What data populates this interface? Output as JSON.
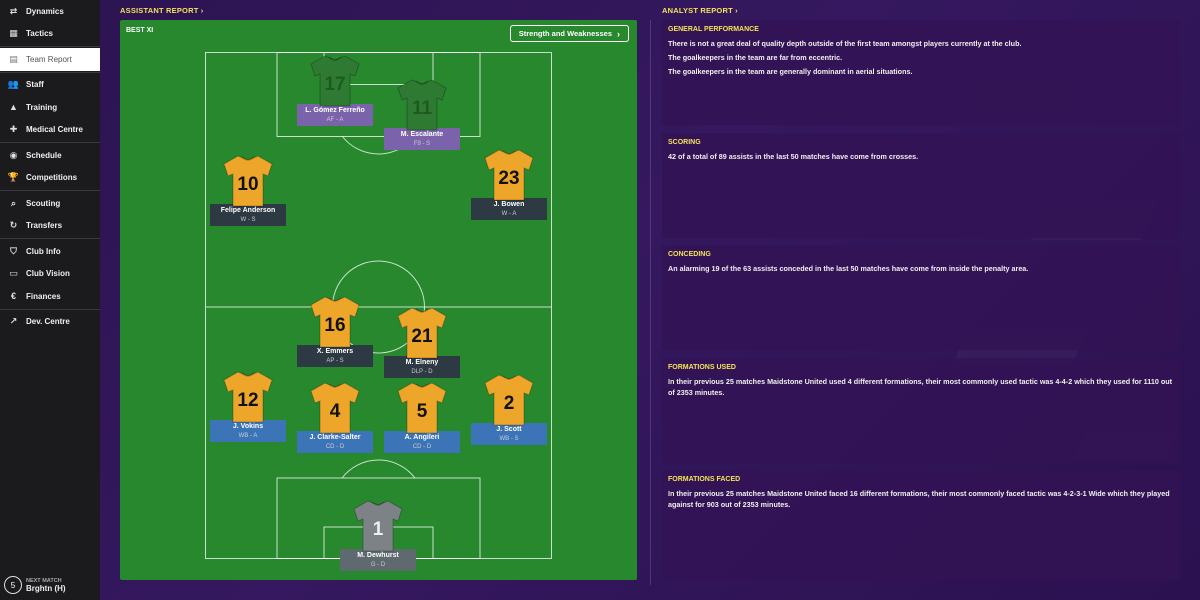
{
  "sidebar": {
    "items": [
      {
        "label": "Dynamics",
        "icon": "dynamics-icon",
        "glyph": "⇄"
      },
      {
        "label": "Tactics",
        "icon": "tactics-icon",
        "glyph": "▦"
      },
      {
        "label": "Team Report",
        "icon": "clipboard-icon",
        "glyph": "▤",
        "active": true
      },
      {
        "label": "Staff",
        "icon": "staff-icon",
        "glyph": "👥"
      },
      {
        "label": "Training",
        "icon": "training-cone-icon",
        "glyph": "▲"
      },
      {
        "label": "Medical Centre",
        "icon": "medical-cross-icon",
        "glyph": "✚"
      },
      {
        "label": "Schedule",
        "icon": "schedule-icon",
        "glyph": "◉"
      },
      {
        "label": "Competitions",
        "icon": "trophy-icon",
        "glyph": "🏆"
      },
      {
        "label": "Scouting",
        "icon": "magnifier-icon",
        "glyph": "⌕"
      },
      {
        "label": "Transfers",
        "icon": "transfers-icon",
        "glyph": "↻"
      },
      {
        "label": "Club Info",
        "icon": "shield-icon",
        "glyph": "⛉"
      },
      {
        "label": "Club Vision",
        "icon": "club-vision-icon",
        "glyph": "▭"
      },
      {
        "label": "Finances",
        "icon": "finances-icon",
        "glyph": "€"
      },
      {
        "label": "Dev. Centre",
        "icon": "dev-centre-icon",
        "glyph": "↗"
      }
    ],
    "next_match": {
      "label": "NEXT MATCH",
      "value": "Brghtn (H)",
      "days": "5"
    }
  },
  "assistant": {
    "heading": "ASSISTANT REPORT",
    "best_xi": "BEST XI",
    "sw_button": "Strength and Weaknesses",
    "players": [
      {
        "name": "L. Gómez Ferreño",
        "role": "AF  -  A",
        "number": "17",
        "kit": "green",
        "label": "purple"
      },
      {
        "name": "M. Escalante",
        "role": "F9  -  S",
        "number": "11",
        "kit": "green",
        "label": "purple"
      },
      {
        "name": "Felipe Anderson",
        "role": "W  -  S",
        "number": "10",
        "kit": "yellow",
        "label": "dark"
      },
      {
        "name": "J. Bowen",
        "role": "W  -  A",
        "number": "23",
        "kit": "yellow",
        "label": "dark"
      },
      {
        "name": "X. Emmers",
        "role": "AP  -  S",
        "number": "16",
        "kit": "yellow",
        "label": "dark"
      },
      {
        "name": "M. Elneny",
        "role": "DLP  -  D",
        "number": "21",
        "kit": "yellow",
        "label": "dark"
      },
      {
        "name": "J. Vokins",
        "role": "WB  -  A",
        "number": "12",
        "kit": "yellow",
        "label": "blue"
      },
      {
        "name": "J. Clarke-Salter",
        "role": "CD  -  D",
        "number": "4",
        "kit": "yellow",
        "label": "blue"
      },
      {
        "name": "A. Angileri",
        "role": "CD  -  D",
        "number": "5",
        "kit": "yellow",
        "label": "blue"
      },
      {
        "name": "J. Scott",
        "role": "WB  -  S",
        "number": "2",
        "kit": "yellow",
        "label": "blue"
      },
      {
        "name": "M. Dewhurst",
        "role": "G  -  D",
        "number": "1",
        "kit": "gray",
        "label": "gray"
      }
    ]
  },
  "analyst": {
    "heading": "ANALYST REPORT",
    "cards": [
      {
        "title": "GENERAL PERFORMANCE",
        "lines": [
          "There is not a great deal of quality depth outside of the first team amongst players currently at the club.",
          "The goalkeepers in the team are far from eccentric.",
          "The goalkeepers in the team are generally dominant in aerial situations."
        ]
      },
      {
        "title": "SCORING",
        "lines": [
          "42 of a total of 89 assists in the last 50 matches have come from crosses."
        ]
      },
      {
        "title": "CONCEDING",
        "lines": [
          "An alarming 19 of the 63 assists conceded in the last 50 matches have come from inside the penalty area."
        ]
      },
      {
        "title": "FORMATIONS USED",
        "lines": [
          "In their previous 25 matches Maidstone United used 4 different formations, their most commonly used tactic was 4-4-2 which they used for 1110 out of 2353 minutes."
        ]
      },
      {
        "title": "FORMATIONS FACED",
        "lines": [
          "In their previous 25 matches Maidstone United faced 16 different formations, their most commonly faced tactic was 4-2-3-1 Wide which they played against for 903 out of 2353 minutes."
        ]
      }
    ]
  },
  "colors": {
    "kit_yellow": "#eda52a",
    "kit_green": "#2f7a32",
    "kit_gray": "#7d8287",
    "accent_yellow": "#f2e35a"
  }
}
